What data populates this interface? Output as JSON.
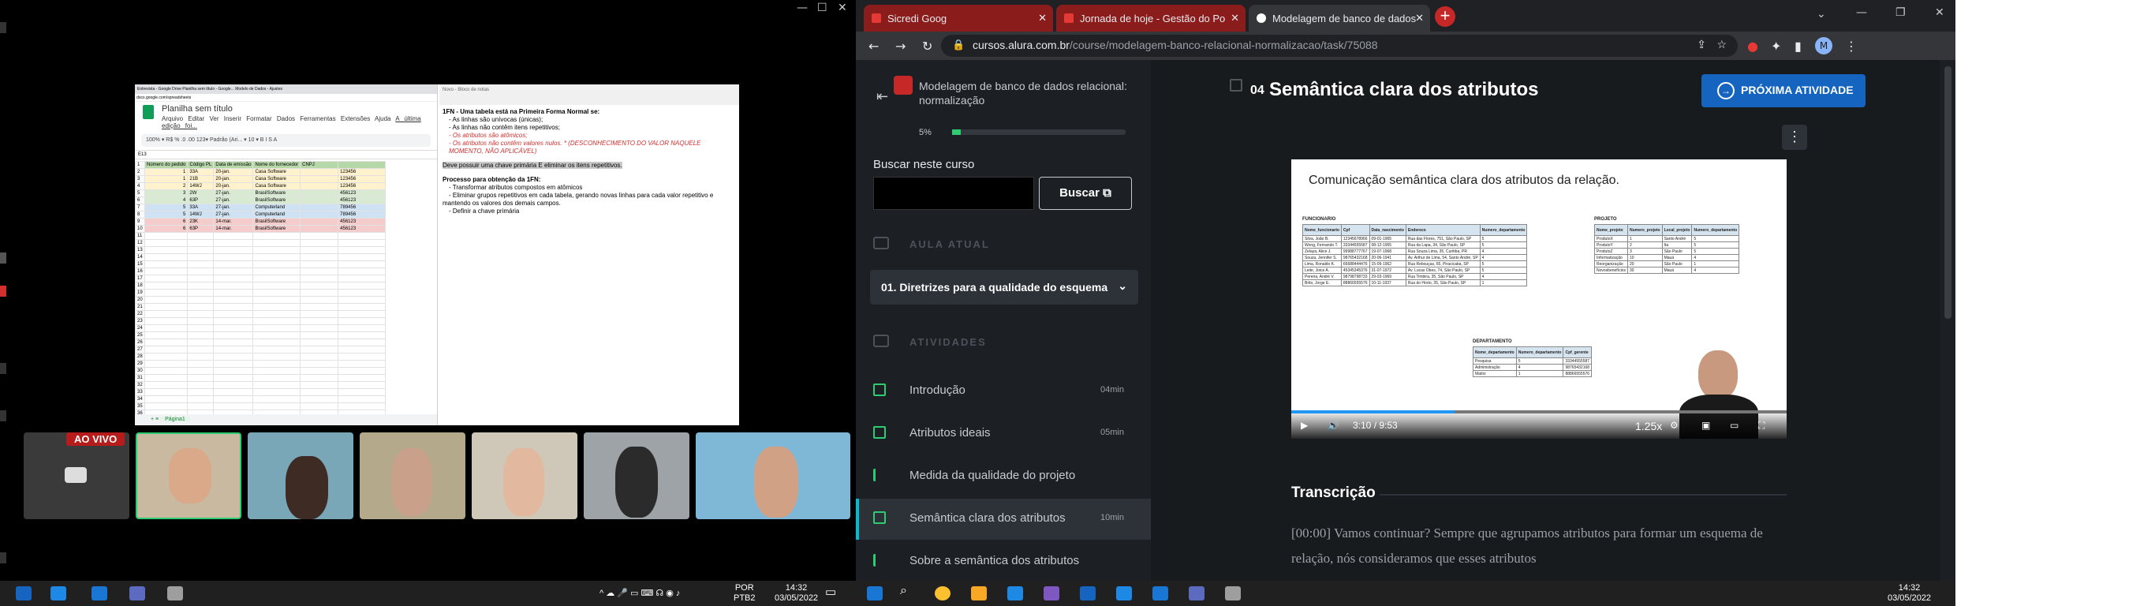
{
  "left_window": {
    "spreadsheet": {
      "tabs_text": "Entrevista - Google Drive   Planilha sem título - Google...   Modelo de Dados - Ajustes",
      "url_text": "docs.google.com/spreadsheets",
      "title": "Planilha sem título",
      "menu": [
        "Arquivo",
        "Editar",
        "Ver",
        "Inserir",
        "Formatar",
        "Dados",
        "Ferramentas",
        "Extensões",
        "Ajuda",
        "A última edição foi..."
      ],
      "toolbar_text": "100%  ▾   R$  %  .0  .00  123▾   Padrão (Ari... ▾   10  ▾   B  I  S  A",
      "cell_ref": "E13",
      "columns": [
        "",
        "Número do pedido",
        "Código PL",
        "Data de emissão",
        "Nome do fornecedor",
        "CNPJ",
        ""
      ],
      "rows": [
        [
          "1",
          "Número do pedido",
          "Código PL",
          "Data de emissão",
          "Nome do fornecedor",
          "CNPJ",
          ""
        ],
        [
          "2",
          "1",
          "33A",
          "20-jan.",
          "Casa Software",
          "",
          "123456"
        ],
        [
          "3",
          "1",
          "21B",
          "20-jan.",
          "Casa Software",
          "",
          "123456"
        ],
        [
          "4",
          "2",
          "14WJ",
          "20-jan.",
          "Casa Software",
          "",
          "123456"
        ],
        [
          "5",
          "3",
          "2W",
          "27-jan.",
          "BrasilSoftware",
          "",
          "456123"
        ],
        [
          "6",
          "4",
          "63P",
          "27-jan.",
          "BrasilSoftware",
          "",
          "456123"
        ],
        [
          "7",
          "5",
          "33A",
          "27-jan.",
          "Computerland",
          "",
          "789456"
        ],
        [
          "8",
          "5",
          "14WJ",
          "27-jan.",
          "Computerland",
          "",
          "789456"
        ],
        [
          "9",
          "6",
          "23K",
          "14-mar.",
          "BrasilSoftware",
          "",
          "456123"
        ],
        [
          "10",
          "6",
          "63P",
          "14-mar.",
          "BrasilSoftware",
          "",
          "456123"
        ]
      ],
      "sheet_tab": "Página1"
    },
    "notes": {
      "bar_text": "Novo - Bloco de notas",
      "heading": "1FN - Uma tabela está na Primeira Forma Normal se:",
      "items": [
        "- As linhas são unívocas (únicas);",
        "- As linhas não contêm itens repetitivos;"
      ],
      "red_items": [
        "- Os atributos são atômicos;",
        "- Os atributos não contêm valores nulos. * (DESCONHECIMENTO DO VALOR NAQUELE MOMENTO, NÃO APLICÁVEL)"
      ],
      "highlight": "Deve possuir uma chave primária E eliminar os itens repetitivos.",
      "process_heading": "Processo para obtenção da 1FN:",
      "process_items": [
        "- Transformar atributos compostos em atômicos",
        "- Eliminar grupos repetitivos em cada tabela, gerando novas linhas para cada valor repetitivo e",
        "mantendo os valores dos demais campos.",
        "- Definir a chave primária"
      ]
    },
    "live_label": "AO VIVO",
    "taskbar": {
      "lang": "POR",
      "lang2": "PTB2",
      "time": "14:32",
      "date": "03/05/2022"
    }
  },
  "browser": {
    "tabs": [
      {
        "title": "Sicredi Goog",
        "color": "#c62828"
      },
      {
        "title": "Jornada de hoje - Gestão do Po",
        "color": "#c62828"
      },
      {
        "title": "Modelagem de banco de dados",
        "color": "#e8eaed"
      }
    ],
    "new_tab": "+",
    "url_domain": "cursos.alura.com.br",
    "url_path": "/course/modelagem-banco-relacional-normalizacao/task/75088",
    "profile_initial": "M"
  },
  "sidebar": {
    "course_title": "Modelagem de banco de dados relacional: normalização",
    "progress_label": "5%",
    "progress": 0.05,
    "search_label": "Buscar neste curso",
    "search_button": "Buscar",
    "section_aula": "AULA ATUAL",
    "current_lesson": "01. Diretrizes para a qualidade do esquema",
    "section_atividades": "ATIVIDADES",
    "activities": [
      {
        "label": "Introdução",
        "duration": "04min"
      },
      {
        "label": "Atributos ideais",
        "duration": "05min"
      },
      {
        "label": "Medida da qualidade do projeto",
        "duration": ""
      },
      {
        "label": "Semântica clara dos atributos",
        "duration": "10min"
      },
      {
        "label": "Sobre a semântica dos atributos",
        "duration": ""
      }
    ]
  },
  "main": {
    "task_number": "04",
    "task_title": "Semântica clara dos atributos",
    "next_button": "PRÓXIMA ATIVIDADE",
    "video": {
      "slide_title": "Comunicação semântica clara dos atributos da relação.",
      "funcionario_label": "FUNCIONARIO",
      "funcionario_headers": [
        "Nome_funcionario",
        "Cpf",
        "Data_nascimento",
        "Endereco",
        "Numero_departamento"
      ],
      "funcionario_rows": [
        [
          "Silva, João B.",
          "12345678966",
          "09-01-1965",
          "Rua das Flores, 751, São Paulo, SP",
          "5"
        ],
        [
          "Wong, Fernando T.",
          "33344555587",
          "08-12-1955",
          "Rua da Lapa, 34, São Paulo, SP",
          "5"
        ],
        [
          "Zelaya, Alice J.",
          "99988777767",
          "19-07-1968",
          "Rua Souza Lima, 35, Curitiba, PR",
          "4"
        ],
        [
          "Souza, Jennifer S.",
          "98765432168",
          "20-06-1941",
          "Av. Arthur de Lima, 54, Santo André, SP",
          "4"
        ],
        [
          "Lima, Ronaldo K.",
          "66688444476",
          "15-09-1962",
          "Rua Rebouças, 65, Piracicaba, SP",
          "5"
        ],
        [
          "Leite, Joice A.",
          "45345345376",
          "31-07-1972",
          "Av. Lucas Obes, 74, São Paulo, SP",
          "5"
        ],
        [
          "Pereira, André V.",
          "98798798733",
          "29-03-1969",
          "Rua Timbira, 35, São Paulo, SP",
          "4"
        ],
        [
          "Brito, Jorge E.",
          "88866555576",
          "10-11-1937",
          "Rua do Horto, 35, São Paulo, SP",
          "1"
        ]
      ],
      "projeto_label": "PROJETO",
      "projeto_headers": [
        "Nome_projeto",
        "Numero_projeto",
        "Local_projeto",
        "Numero_departamento"
      ],
      "projeto_rows": [
        [
          "ProdutoX",
          "1",
          "Santo André",
          "5"
        ],
        [
          "ProdutoY",
          "2",
          "Ita",
          "5"
        ],
        [
          "ProdutoZ",
          "3",
          "São Paulo",
          "5"
        ],
        [
          "Informatização",
          "10",
          "Mauá",
          "4"
        ],
        [
          "Reorganização",
          "20",
          "São Paulo",
          "1"
        ],
        [
          "Novosbenefícios",
          "30",
          "Mauá",
          "4"
        ]
      ],
      "departamento_label": "DEPARTAMENTO",
      "departamento_headers": [
        "Nome_departamento",
        "Numero_departamento",
        "Cpf_gerente"
      ],
      "departamento_rows": [
        [
          "Pesquisa",
          "5",
          "33344555587"
        ],
        [
          "Administração",
          "4",
          "98765432168"
        ],
        [
          "Matriz",
          "1",
          "88866555576"
        ]
      ],
      "current_time": "3:10",
      "duration": "9:53",
      "speed": "1.25x",
      "played_fraction": 0.33
    },
    "transcript_heading": "Transcrição",
    "transcript_text": "[00:00] Vamos continuar? Sempre que agrupamos atributos para formar um esquema de relação, nós consideramos que esses atributos"
  },
  "taskbar_right": {
    "time": "14:32",
    "date": "03/05/2022"
  }
}
